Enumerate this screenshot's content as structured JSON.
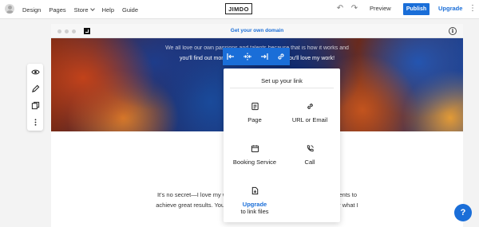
{
  "topbar": {
    "nav": [
      "Design",
      "Pages",
      "Store",
      "Help",
      "Guide"
    ],
    "logo": "JIMDO",
    "preview": "Preview",
    "publish": "Publish",
    "upgrade": "Upgrade"
  },
  "browser": {
    "domain_link": "Get your own domain"
  },
  "hero": {
    "line1": "We all love our own passions and talents because that is how it works and",
    "line2": "you'll find out more about what I do. I hope you'll love my work!"
  },
  "body": {
    "line1": "It's no secret—I love my work! But for me, it's all about helping my clients to",
    "line2": "achieve great results. You can find more about what I do and discover what I"
  },
  "popup": {
    "title": "Set up your link",
    "options": [
      {
        "label": "Page",
        "icon": "page-icon"
      },
      {
        "label": "URL or Email",
        "icon": "link-icon"
      },
      {
        "label": "Booking Service",
        "icon": "calendar-icon"
      },
      {
        "label": "Call",
        "icon": "phone-icon"
      }
    ],
    "upgrade_label": "Upgrade",
    "upgrade_sub": "to link files"
  },
  "help": "?",
  "colors": {
    "accent": "#1a6ed8"
  }
}
